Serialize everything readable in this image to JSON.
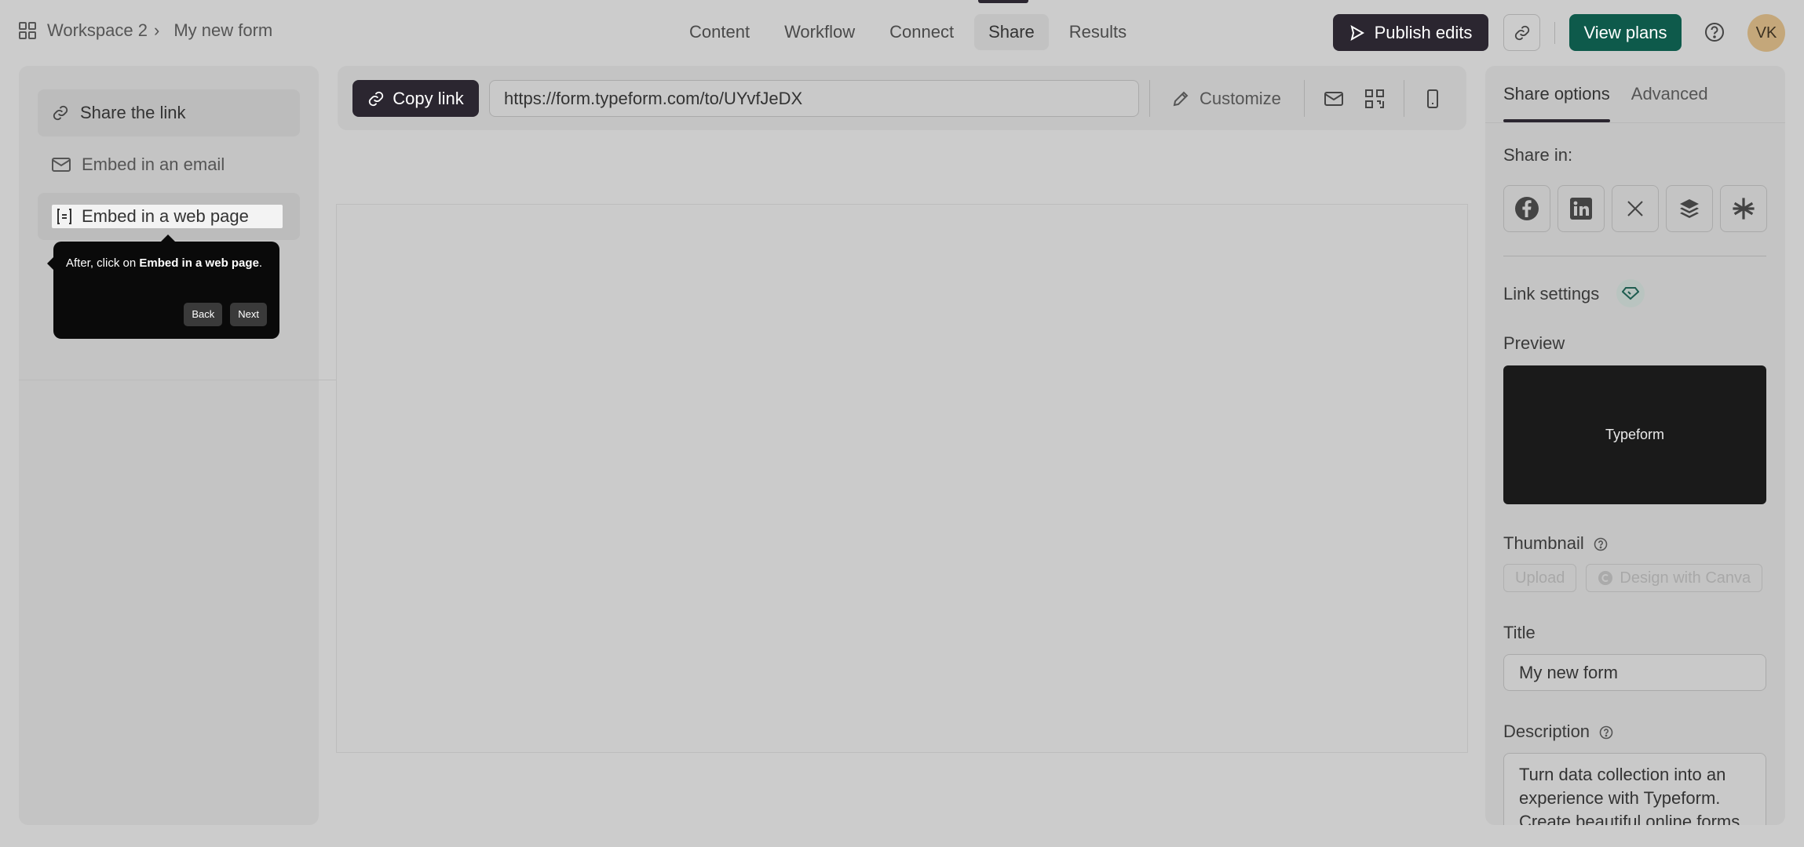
{
  "header": {
    "workspace": "Workspace 2",
    "form_name": "My new form",
    "tabs": [
      {
        "label": "Content"
      },
      {
        "label": "Workflow"
      },
      {
        "label": "Connect"
      },
      {
        "label": "Share"
      },
      {
        "label": "Results"
      }
    ],
    "active_tab": "Share",
    "publish_label": "Publish edits",
    "view_plans_label": "View plans",
    "avatar_initials": "VK"
  },
  "left_panel": {
    "items": [
      {
        "label": "Share the link",
        "icon": "link-icon"
      },
      {
        "label": "Embed in an email",
        "icon": "mail-icon"
      },
      {
        "label": "Embed in a web page",
        "icon": "code-brackets-icon"
      }
    ]
  },
  "tooltip": {
    "text_prefix": "After, click on ",
    "text_bold": "Embed in a web page",
    "text_suffix": ".",
    "back_label": "Back",
    "next_label": "Next"
  },
  "toolbar": {
    "copy_link_label": "Copy link",
    "url": "https://form.typeform.com/to/UYvfJeDX",
    "customize_label": "Customize"
  },
  "right_panel": {
    "tabs": [
      {
        "label": "Share options"
      },
      {
        "label": "Advanced"
      }
    ],
    "share_in_label": "Share in:",
    "social": [
      "facebook-icon",
      "linkedin-icon",
      "x-icon",
      "buffer-icon",
      "linktree-icon"
    ],
    "link_settings_label": "Link settings",
    "preview_label": "Preview",
    "preview_card_text": "Typeform",
    "thumbnail_label": "Thumbnail",
    "upload_label": "Upload",
    "canva_label": "Design with Canva",
    "title_label": "Title",
    "title_value": "My new form",
    "description_label": "Description",
    "description_value": "Turn data collection into an experience with Typeform. Create beautiful online forms, surveys, quizzes, and so much more."
  },
  "colors": {
    "accent_dark": "#2b2630",
    "view_plans": "#0e5a4b",
    "avatar": "#c4a77a"
  }
}
